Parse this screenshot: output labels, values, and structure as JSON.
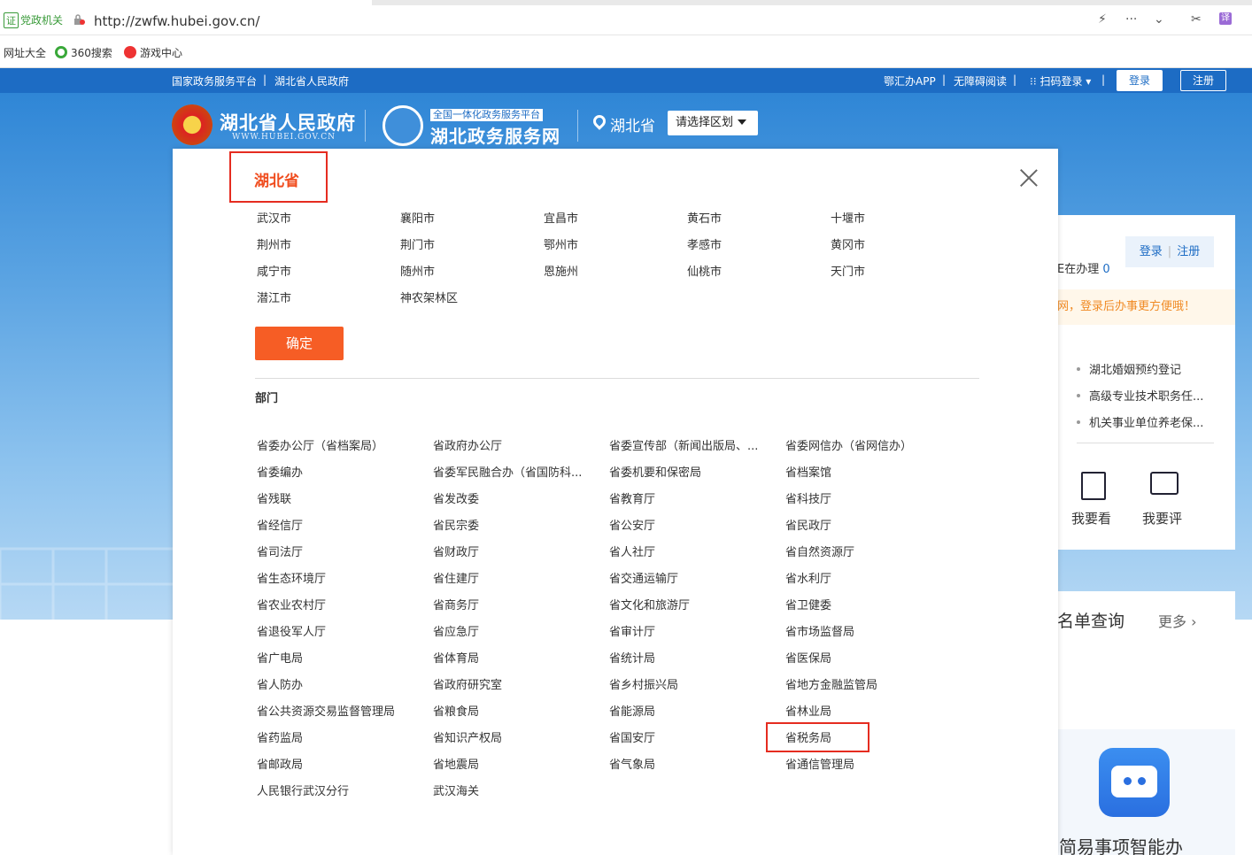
{
  "browser": {
    "cert_label": "党政机关",
    "cert_badge": "证",
    "url": "http://zwfw.hubei.gov.cn/",
    "bookmarks": [
      "网址大全",
      "360搜索",
      "游戏中心"
    ]
  },
  "topbar": {
    "left_links": [
      "国家政务服务平台",
      "湖北省人民政府"
    ],
    "right_links": [
      "鄂汇办APP",
      "无障碍阅读",
      "扫码登录"
    ],
    "login_label": "登录",
    "register_label": "注册"
  },
  "header": {
    "gov_title": "湖北省人民政府",
    "gov_subtitle": "WWW.HUBEI.GOV.CN",
    "service_tag": "全国一体化政务服务平台",
    "service_title": "湖北政务服务网",
    "location": "湖北省",
    "region_select": "请选择区划"
  },
  "popup": {
    "province": "湖北省",
    "cities": [
      [
        "武汉市",
        "襄阳市",
        "宜昌市",
        "黄石市",
        "十堰市"
      ],
      [
        "荆州市",
        "荆门市",
        "鄂州市",
        "孝感市",
        "黄冈市"
      ],
      [
        "咸宁市",
        "随州市",
        "恩施州",
        "仙桃市",
        "天门市"
      ],
      [
        "潜江市",
        "神农架林区"
      ]
    ],
    "confirm_label": "确定",
    "dept_heading": "部门",
    "departments": [
      [
        "省委办公厅（省档案局）",
        "省政府办公厅",
        "省委宣传部（新闻出版局、...",
        "省委网信办（省网信办）"
      ],
      [
        "省委编办",
        "省委军民融合办（省国防科...",
        "省委机要和保密局",
        "省档案馆"
      ],
      [
        "省残联",
        "省发改委",
        "省教育厅",
        "省科技厅"
      ],
      [
        "省经信厅",
        "省民宗委",
        "省公安厅",
        "省民政厅"
      ],
      [
        "省司法厅",
        "省财政厅",
        "省人社厅",
        "省自然资源厅"
      ],
      [
        "省生态环境厅",
        "省住建厅",
        "省交通运输厅",
        "省水利厅"
      ],
      [
        "省农业农村厅",
        "省商务厅",
        "省文化和旅游厅",
        "省卫健委"
      ],
      [
        "省退役军人厅",
        "省应急厅",
        "省审计厅",
        "省市场监督局"
      ],
      [
        "省广电局",
        "省体育局",
        "省统计局",
        "省医保局"
      ],
      [
        "省人防办",
        "省政府研究室",
        "省乡村振兴局",
        "省地方金融监管局"
      ],
      [
        "省公共资源交易监督管理局",
        "省粮食局",
        "省能源局",
        "省林业局"
      ],
      [
        "省药监局",
        "省知识产权局",
        "省国安厅",
        "省税务局"
      ],
      [
        "省邮政局",
        "省地震局",
        "省气象局",
        "省通信管理局"
      ],
      [
        "人民银行武汉分行",
        "武汉海关"
      ]
    ]
  },
  "right_panel": {
    "doing_label": "E在办理",
    "doing_count": "0",
    "login": "登录",
    "register": "注册",
    "notice": "网，登录后办事更方便哦！",
    "items": [
      "湖北婚姻预约登记",
      "高级专业技术职务任...",
      "机关事业单位养老保..."
    ],
    "see_label": "我要看",
    "rate_label": "我要评",
    "list_query": "名单查询",
    "more": "更多 ›",
    "smart_title": "简易事项智能办"
  },
  "colors": {
    "brand_blue": "#1d6cc4",
    "accent_orange": "#f65d25",
    "highlight_red": "#e52c20"
  }
}
